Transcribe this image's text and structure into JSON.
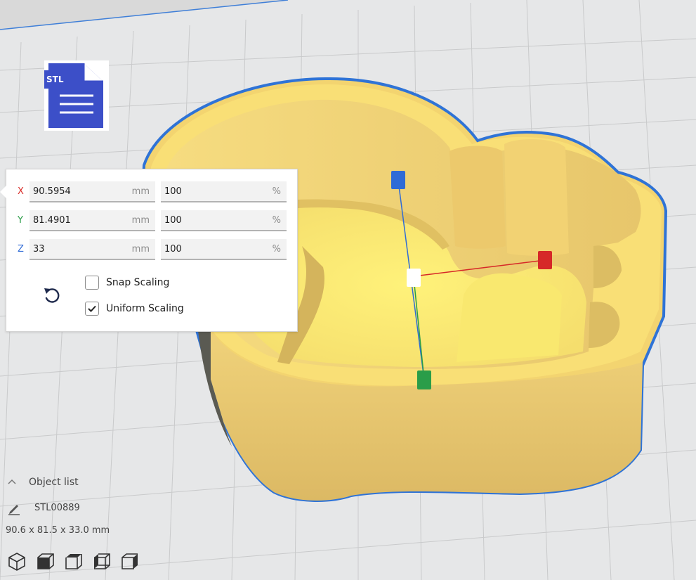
{
  "stl_icon": {
    "label": "STL"
  },
  "scale_panel": {
    "rows": [
      {
        "axis": "X",
        "axis_color": "#d9302c",
        "value": "90.5954",
        "unit": "mm",
        "percent": "100",
        "percent_unit": "%"
      },
      {
        "axis": "Y",
        "axis_color": "#2e9e4a",
        "value": "81.4901",
        "unit": "mm",
        "percent": "100",
        "percent_unit": "%"
      },
      {
        "axis": "Z",
        "axis_color": "#2f6bd6",
        "value": "33",
        "unit": "mm",
        "percent": "100",
        "percent_unit": "%"
      }
    ],
    "snap_scaling": {
      "label": "Snap Scaling",
      "checked": false
    },
    "uniform_scaling": {
      "label": "Uniform Scaling",
      "checked": true
    },
    "reset_icon": "undo-icon"
  },
  "object_list": {
    "header": "Object list",
    "object_name": "STL00889",
    "dimensions": "90.6 x 81.5 x 33.0 mm"
  },
  "view_buttons": [
    "3d-view-icon",
    "front-view-icon",
    "top-view-icon",
    "left-view-icon",
    "right-view-icon"
  ],
  "colors": {
    "model": "#f7d87a",
    "outline": "#2f73d6",
    "build_plate": "#e6e7e8",
    "handle_x": "#d62828",
    "handle_y": "#2a9d49",
    "handle_z": "#2f6bd6"
  }
}
